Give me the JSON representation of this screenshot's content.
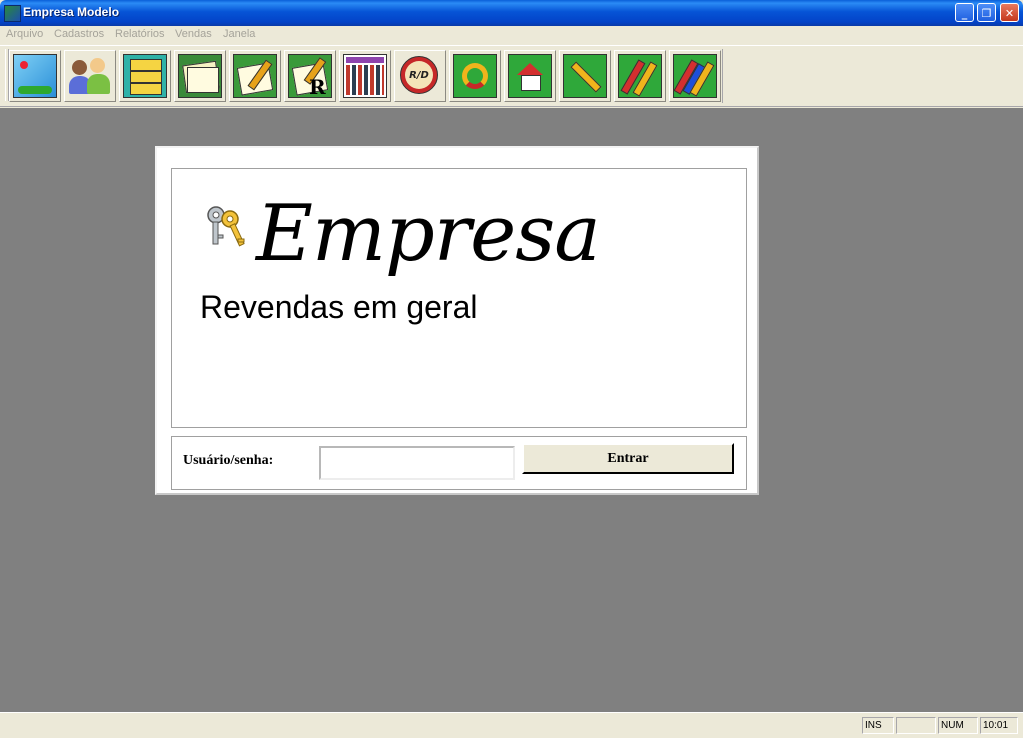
{
  "window": {
    "title": "Empresa Modelo",
    "controls": {
      "minimize": "_",
      "maximize": "❐",
      "close": "✕"
    }
  },
  "menu": {
    "items": [
      {
        "label": "Arquivo"
      },
      {
        "label": "Cadastros"
      },
      {
        "label": "Relatórios"
      },
      {
        "label": "Vendas"
      },
      {
        "label": "Janela"
      }
    ]
  },
  "toolbar": {
    "buttons": [
      {
        "icon": "map-icon"
      },
      {
        "icon": "users-icon"
      },
      {
        "icon": "file-cabinet-icon"
      },
      {
        "icon": "documents-icon"
      },
      {
        "icon": "edit-note-icon"
      },
      {
        "icon": "edit-report-icon",
        "overlay": "R"
      },
      {
        "icon": "calendar-icon"
      },
      {
        "icon": "rd-icon",
        "overlay": "R/D"
      },
      {
        "icon": "refresh-icon"
      },
      {
        "icon": "home-icon"
      },
      {
        "icon": "pen-icon"
      },
      {
        "icon": "checkmark-icon"
      },
      {
        "icon": "checkmark-blue-icon"
      }
    ]
  },
  "login": {
    "brand": "Empresa",
    "tagline": "Revendas em geral",
    "label": "Usuário/senha:",
    "input_value": "",
    "button": "Entrar"
  },
  "statusbar": {
    "ins": "INS",
    "blank": "",
    "num": "NUM",
    "time": "10:01"
  },
  "colors": {
    "titlebar": "#0a5fd8",
    "mdi_background": "#808080",
    "chrome": "#ece9d8"
  }
}
